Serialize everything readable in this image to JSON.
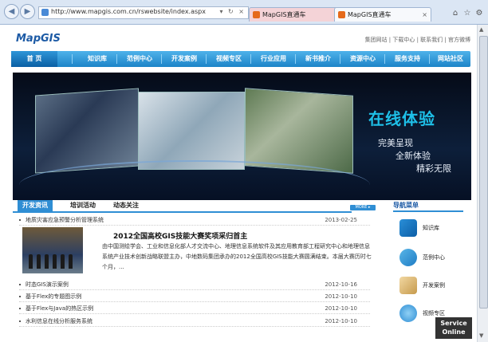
{
  "browser": {
    "url": "http://www.mapgis.com.cn/rswebsite/index.aspx",
    "url_controls": "▾ ↻ ×",
    "tabs": [
      {
        "title": "MapGIS直通车"
      },
      {
        "title": "MapGIS直通车"
      }
    ]
  },
  "site": {
    "logo_text": "MapGIS",
    "top_links": "集团网站 | 下载中心 | 联系我们 | 官方微博",
    "nav": [
      "首 页",
      "知识库",
      "范例中心",
      "开发案例",
      "视频专区",
      "行业应用",
      "新书推介",
      "资源中心",
      "服务支持",
      "网站社区"
    ],
    "banner": {
      "title": "在线体验",
      "lines": [
        "完美呈现",
        "全新体验",
        "精彩无限"
      ]
    },
    "news_tabs": [
      "开发资讯",
      "培训活动",
      "动态关注"
    ],
    "more_label": "MORE ▸",
    "news_top": {
      "title": "地质灾害应急预警分析管理系统",
      "date": "2013-02-25"
    },
    "feature": {
      "title": "2012全国高校GIS技能大赛奖项采归首主",
      "body": "由中国测绘学会、工业和信息化部人才交流中心、地理信息系统软件及其应用教育部工程研究中心和地理信息系统产业技术创新战略联盟主办，中地数码集团承办的2012全国高校GIS技能大赛圆满结束。本届大赛历时七个月，..."
    },
    "news_list": [
      {
        "title": "时态GIS演示案例",
        "date": "2012-10-16"
      },
      {
        "title": "基于Flex的专题图示例",
        "date": "2012-10-10"
      },
      {
        "title": "基于Flex与Java的热区示例",
        "date": "2012-10-10"
      },
      {
        "title": "水利信息在线分析服务系统",
        "date": "2012-10-10"
      }
    ],
    "side_menu": {
      "title": "导航菜单",
      "items": [
        "知识库",
        "范例中心",
        "开发案例",
        "视频专区"
      ]
    },
    "service_label": [
      "Service",
      "Online"
    ]
  },
  "colors": {
    "nav_blue": "#1c84c8",
    "accent": "#2f8ed4",
    "banner_title": "#1ec0e8"
  }
}
